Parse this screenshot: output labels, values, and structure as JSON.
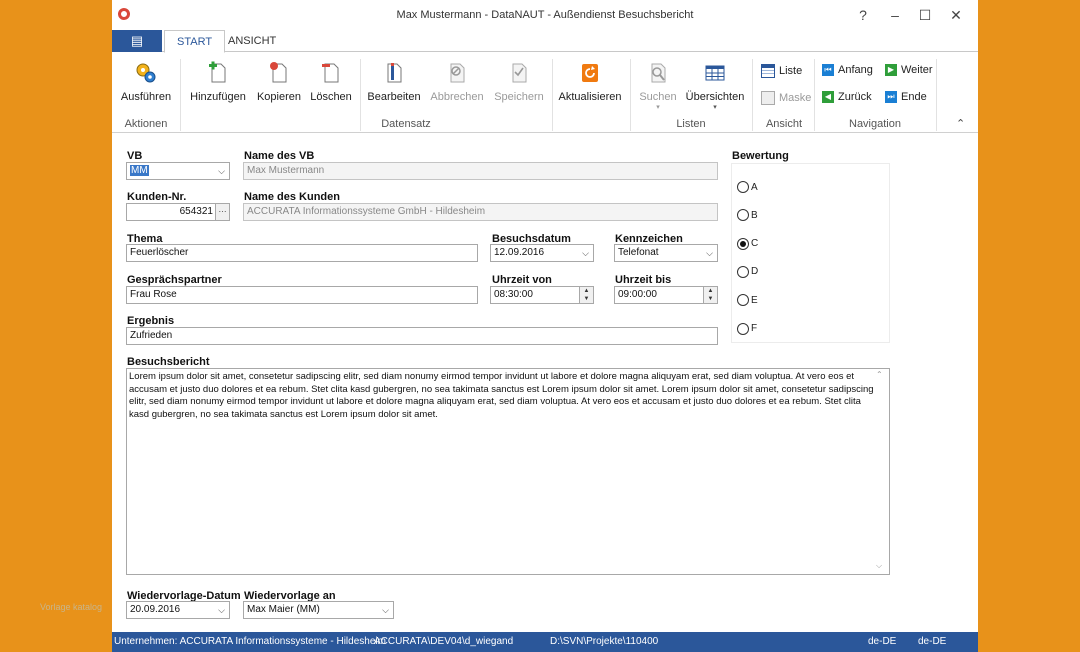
{
  "window": {
    "title": "Max Mustermann - DataNAUT - Außendienst Besuchsbericht"
  },
  "window_controls": {
    "help": "?",
    "minimize": "–",
    "maximize": "☐",
    "close": "✕"
  },
  "tabs": {
    "file": "▤",
    "start": "START",
    "view": "ANSICHT"
  },
  "ribbon": {
    "run": "Ausführen",
    "add": "Hinzufügen",
    "copy": "Kopieren",
    "delete": "Löschen",
    "edit": "Bearbeiten",
    "cancel": "Abbrechen",
    "save": "Speichern",
    "refresh": "Aktualisieren",
    "search": "Suchen",
    "overviews": "Übersichten",
    "list": "Liste",
    "mask": "Maske",
    "first": "Anfang",
    "back": "Zurück",
    "next": "Weiter",
    "last": "Ende",
    "groups": {
      "actions": "Aktionen",
      "record": "Datensatz",
      "lists": "Listen",
      "view": "Ansicht",
      "navigation": "Navigation"
    },
    "collapse": "⌃"
  },
  "form": {
    "vb_label": "VB",
    "vb_value": "MM",
    "vb_name_label": "Name des VB",
    "vb_name_value": "Max Mustermann",
    "customer_no_label": "Kunden-Nr.",
    "customer_no_value": "654321",
    "ellipsis": "···",
    "customer_name_label": "Name des Kunden",
    "customer_name_value": "ACCURATA Informationssysteme GmbH - Hildesheim",
    "topic_label": "Thema",
    "topic_value": "Feuerlöscher",
    "visit_date_label": "Besuchsdatum",
    "visit_date_value": "12.09.2016",
    "mark_label": "Kennzeichen",
    "mark_value": "Telefonat",
    "contact_label": "Gesprächspartner",
    "contact_value": "Frau Rose",
    "time_from_label": "Uhrzeit von",
    "time_from_value": "08:30:00",
    "time_to_label": "Uhrzeit bis",
    "time_to_value": "09:00:00",
    "result_label": "Ergebnis",
    "result_value": "Zufrieden",
    "report_label": "Besuchsbericht",
    "report_text": "Lorem ipsum dolor sit amet, consetetur sadipscing elitr, sed diam nonumy eirmod tempor invidunt ut labore et dolore magna aliquyam erat, sed diam voluptua. At vero eos et accusam et justo duo dolores et ea rebum. Stet clita kasd gubergren, no sea takimata sanctus est Lorem ipsum dolor sit amet. Lorem ipsum dolor sit amet, consetetur sadipscing elitr, sed diam nonumy eirmod tempor invidunt ut labore et dolore magna aliquyam erat, sed diam voluptua. At vero eos et accusam et justo duo dolores et ea rebum. Stet clita kasd gubergren, no sea takimata sanctus est Lorem ipsum dolor sit amet.",
    "followup_date_label": "Wiedervorlage-Datum",
    "followup_date_value": "20.09.2016",
    "followup_to_label": "Wiedervorlage an",
    "followup_to_value": "Max Maier (MM)",
    "rating_label": "Bewertung",
    "rating_options": [
      "A",
      "B",
      "C",
      "D",
      "E",
      "F"
    ],
    "rating_selected": "C"
  },
  "statusbar": {
    "company": "Unternehmen: ACCURATA Informationssysteme - Hildesheim",
    "user": "ACCURATA\\DEV04\\d_wiegand",
    "path": "D:\\SVN\\Projekte\\110400",
    "lang1": "de-DE",
    "lang2": "de-DE"
  },
  "watermark": "Vorlage katalog",
  "colors": {
    "accent": "#2b579a",
    "frame": "#e8921a",
    "navigation": "#1a7fd4",
    "navigation_green": "#2f9e3a",
    "refresh": "#f07a10"
  }
}
